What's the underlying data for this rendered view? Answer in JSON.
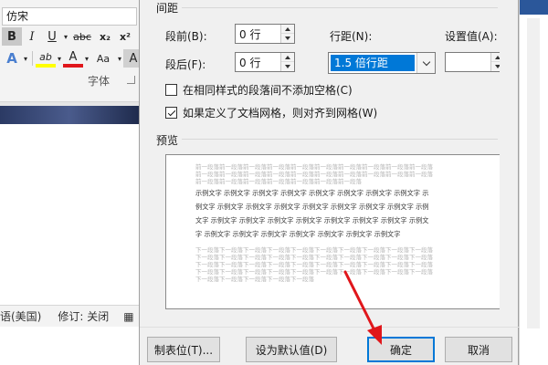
{
  "background": {
    "font_name": "仿宋",
    "format_buttons": [
      "B",
      "I",
      "U",
      "abc",
      "x₂",
      "x²"
    ],
    "row2_buttons": [
      "A",
      "ab",
      "A",
      "Aa",
      "A"
    ],
    "group_label": "字体",
    "status_language": "语(美国)",
    "status_track": "修订: 关闭"
  },
  "dialog": {
    "section_spacing": "间距",
    "before_label": "段前(B):",
    "before_value": "0 行",
    "after_label": "段后(F):",
    "after_value": "0 行",
    "line_spacing_label": "行距(N):",
    "line_spacing_value": "1.5 倍行距",
    "set_value_label": "设置值(A):",
    "set_value_value": "",
    "check_same_style": "在相同样式的段落间不添加空格(C)",
    "check_same_style_checked": false,
    "check_grid": "如果定义了文档网格，则对齐到网格(W)",
    "check_grid_checked": true,
    "section_preview": "预览",
    "preview": {
      "prev_lines": [
        "前一段落前一段落前一段落前一段落前一段落前一段落前一段落前一段落前一段落前一段落",
        "前一段落前一段落前一段落前一段落前一段落前一段落前一段落前一段落前一段落前一段落",
        "前一段落前一段落前一段落前一段落前一段落前一段落前一段落"
      ],
      "sample_lines": [
        "示例文字 示例文字 示例文字 示例文字 示例文字 示例文字 示例文字 示例文字 示",
        "例文字 示例文字 示例文字 示例文字 示例文字 示例文字 示例文字 示例文字 示例",
        "文字 示例文字 示例文字 示例文字 示例文字 示例文字 示例文字 示例文字 示例文",
        "字 示例文字 示例文字 示例文字 示例文字 示例文字 示例文字 示例文字"
      ],
      "next_lines": [
        "下一段落下一段落下一段落下一段落下一段落下一段落下一段落下一段落下一段落下一段落",
        "下一段落下一段落下一段落下一段落下一段落下一段落下一段落下一段落下一段落下一段落",
        "下一段落下一段落下一段落下一段落下一段落下一段落下一段落下一段落下一段落下一段落",
        "下一段落下一段落下一段落下一段落下一段落下一段落下一段落下一段落下一段落下一段落",
        "下一段落下一段落下一段落下一段落下一段落"
      ]
    },
    "btn_tabs": "制表位(T)...",
    "btn_default": "设为默认值(D)",
    "btn_ok": "确定",
    "btn_cancel": "取消"
  },
  "colors": {
    "selection": "#0078d7",
    "arrow": "#e0161b",
    "word_blue": "#2b579a"
  }
}
